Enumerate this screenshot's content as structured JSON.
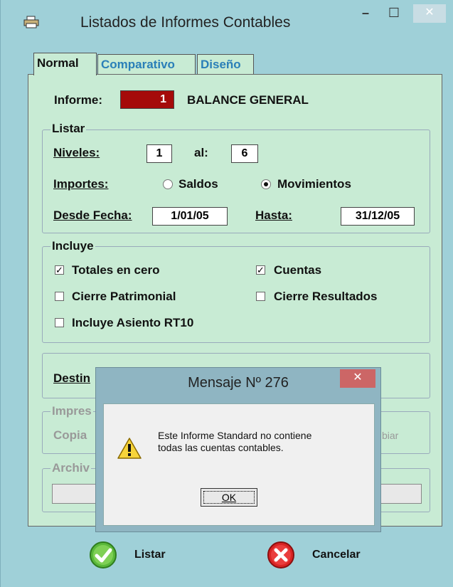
{
  "window": {
    "title": "Listados de Informes Contables",
    "minimize": "–",
    "maximize": "☐",
    "close": "✕"
  },
  "tabs": [
    {
      "label": "Normal"
    },
    {
      "label": "Comparativo"
    },
    {
      "label": "Diseño"
    }
  ],
  "informe": {
    "label": "Informe:",
    "number": "1",
    "name": "BALANCE GENERAL"
  },
  "listar": {
    "title": "Listar",
    "niveles_label": "Niveles:",
    "niveles_from": "1",
    "al_label": "al:",
    "niveles_to": "6",
    "importes_label": "Importes:",
    "saldos_label": "Saldos",
    "movimientos_label": "Movimientos",
    "desde_label": "Desde Fecha:",
    "desde_value": "1/01/05",
    "hasta_label": "Hasta:",
    "hasta_value": "31/12/05"
  },
  "incluye": {
    "title": "Incluye",
    "totales_cero": "Totales en cero",
    "cuentas": "Cuentas",
    "cierre_patrimonial": "Cierre Patrimonial",
    "cierre_resultados": "Cierre Resultados",
    "asiento_rt10": "Incluye Asiento RT10"
  },
  "destino": {
    "label": "Destin"
  },
  "impresora": {
    "title": "Impres",
    "copias_label": "Copia",
    "cambiar_label": "biar"
  },
  "archivo": {
    "title": "Archiv"
  },
  "actions": {
    "listar": "Listar",
    "cancelar": "Cancelar"
  },
  "dialog": {
    "title": "Mensaje Nº 276",
    "close": "✕",
    "line1": "Este Informe Standard no contiene",
    "line2": "todas las cuentas contables.",
    "ok": "OK"
  }
}
